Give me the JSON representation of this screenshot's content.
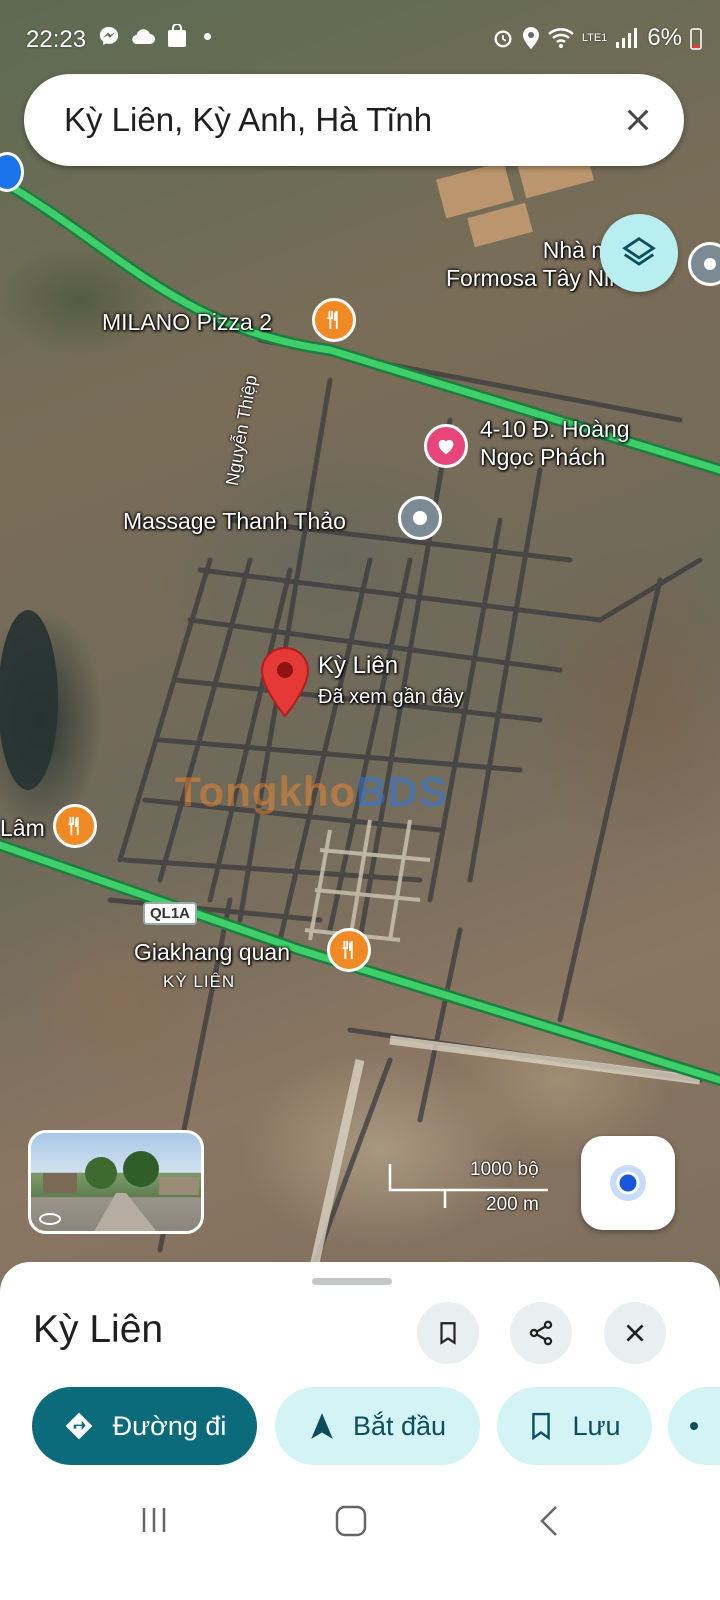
{
  "status_bar": {
    "time": "22:23",
    "battery": "6%",
    "network": "LTE1"
  },
  "search": {
    "query": "Kỳ Liên, Kỳ Anh, Hà Tĩnh"
  },
  "map": {
    "pois": [
      {
        "id": "factory",
        "label": "Nhà máy\nFormosa Tây Ninh",
        "type": "gray"
      },
      {
        "id": "milano",
        "label": "MILANO Pizza 2",
        "type": "food"
      },
      {
        "id": "hoang",
        "label": "4-10 Đ. Hoàng\nNgọc Phách",
        "type": "heart"
      },
      {
        "id": "massage",
        "label": "Massage Thanh Thảo",
        "type": "gray"
      },
      {
        "id": "lam",
        "label": "Lâm",
        "type": "food"
      },
      {
        "id": "giakhang",
        "label": "Giakhang quan",
        "type": "food"
      }
    ],
    "pin": {
      "title": "Kỳ Liên",
      "subtitle": "Đã xem gần đây"
    },
    "street_label": "Nguyễn Thiệp",
    "route_shield": "QL1A",
    "area_label": "KỲ LIÊN",
    "watermark": {
      "part1": "Tongkho",
      "part2": "BDS"
    },
    "scale": {
      "imperial": "1000 bộ",
      "metric": "200 m"
    }
  },
  "sheet": {
    "title": "Kỳ Liên",
    "buttons": {
      "directions": "Đường đi",
      "start": "Bắt đầu",
      "save": "Lưu"
    }
  },
  "colors": {
    "accent": "#0b6b7b",
    "accent_light": "#d3f3f5",
    "pin": "#e53935",
    "highway": "#3fcf6a"
  }
}
